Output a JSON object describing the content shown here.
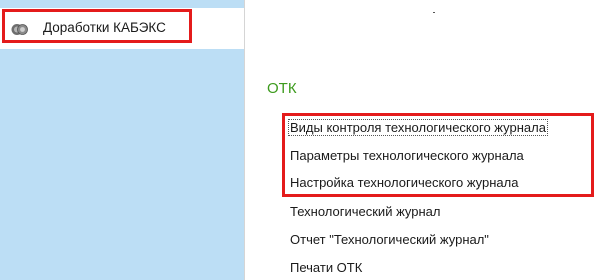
{
  "sidebar": {
    "items": [
      {
        "label": "Доработки КАБЭКС",
        "icon": "subsystem-icon"
      }
    ]
  },
  "main": {
    "section_title": "ОТК",
    "commands": [
      "Виды контроля технологического журнала",
      "Параметры технологического журнала",
      "Настройка технологического журнала",
      "Технологический журнал",
      "Отчет \"Технологический журнал\"",
      "Печати ОТК"
    ]
  },
  "colors": {
    "sidebar_bg": "#bcdef5",
    "section_title": "#3d9b1d",
    "highlight": "#e41b1b"
  }
}
